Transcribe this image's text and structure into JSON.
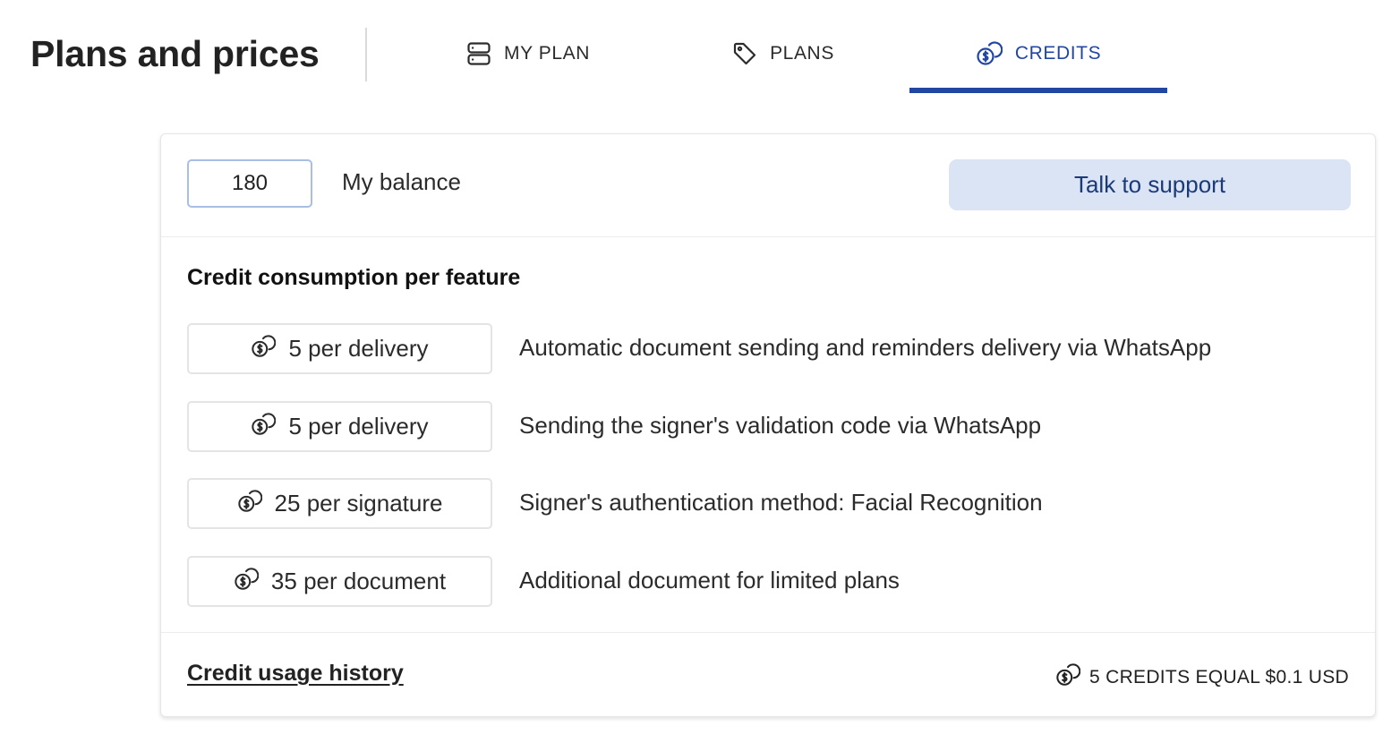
{
  "header": {
    "title": "Plans and prices",
    "tabs": [
      {
        "label": "MY PLAN",
        "icon": "server-icon",
        "active": false
      },
      {
        "label": "PLANS",
        "icon": "tag-icon",
        "active": false
      },
      {
        "label": "CREDITS",
        "icon": "coins-icon",
        "active": true
      }
    ]
  },
  "colors": {
    "accent": "#2147a3",
    "support_button_bg": "#dbe4f4",
    "balance_border": "#a9bee3"
  },
  "balance": {
    "value": "180",
    "label": "My balance",
    "support_button_label": "Talk to support"
  },
  "consumption": {
    "title": "Credit consumption per feature",
    "items": [
      {
        "icon": "coins-icon",
        "cost": "5 per delivery",
        "description": "Automatic document sending and reminders delivery via WhatsApp"
      },
      {
        "icon": "coins-icon",
        "cost": "5 per delivery",
        "description": "Sending the signer's validation code via WhatsApp"
      },
      {
        "icon": "coins-icon",
        "cost": "25 per signature",
        "description": "Signer's authentication method: Facial Recognition"
      },
      {
        "icon": "coins-icon",
        "cost": "35 per document",
        "description": "Additional document for limited plans"
      }
    ]
  },
  "footer": {
    "history_link": "Credit usage history",
    "rate_icon": "coins-icon",
    "rate_text": "5 CREDITS EQUAL $0.1 USD"
  }
}
